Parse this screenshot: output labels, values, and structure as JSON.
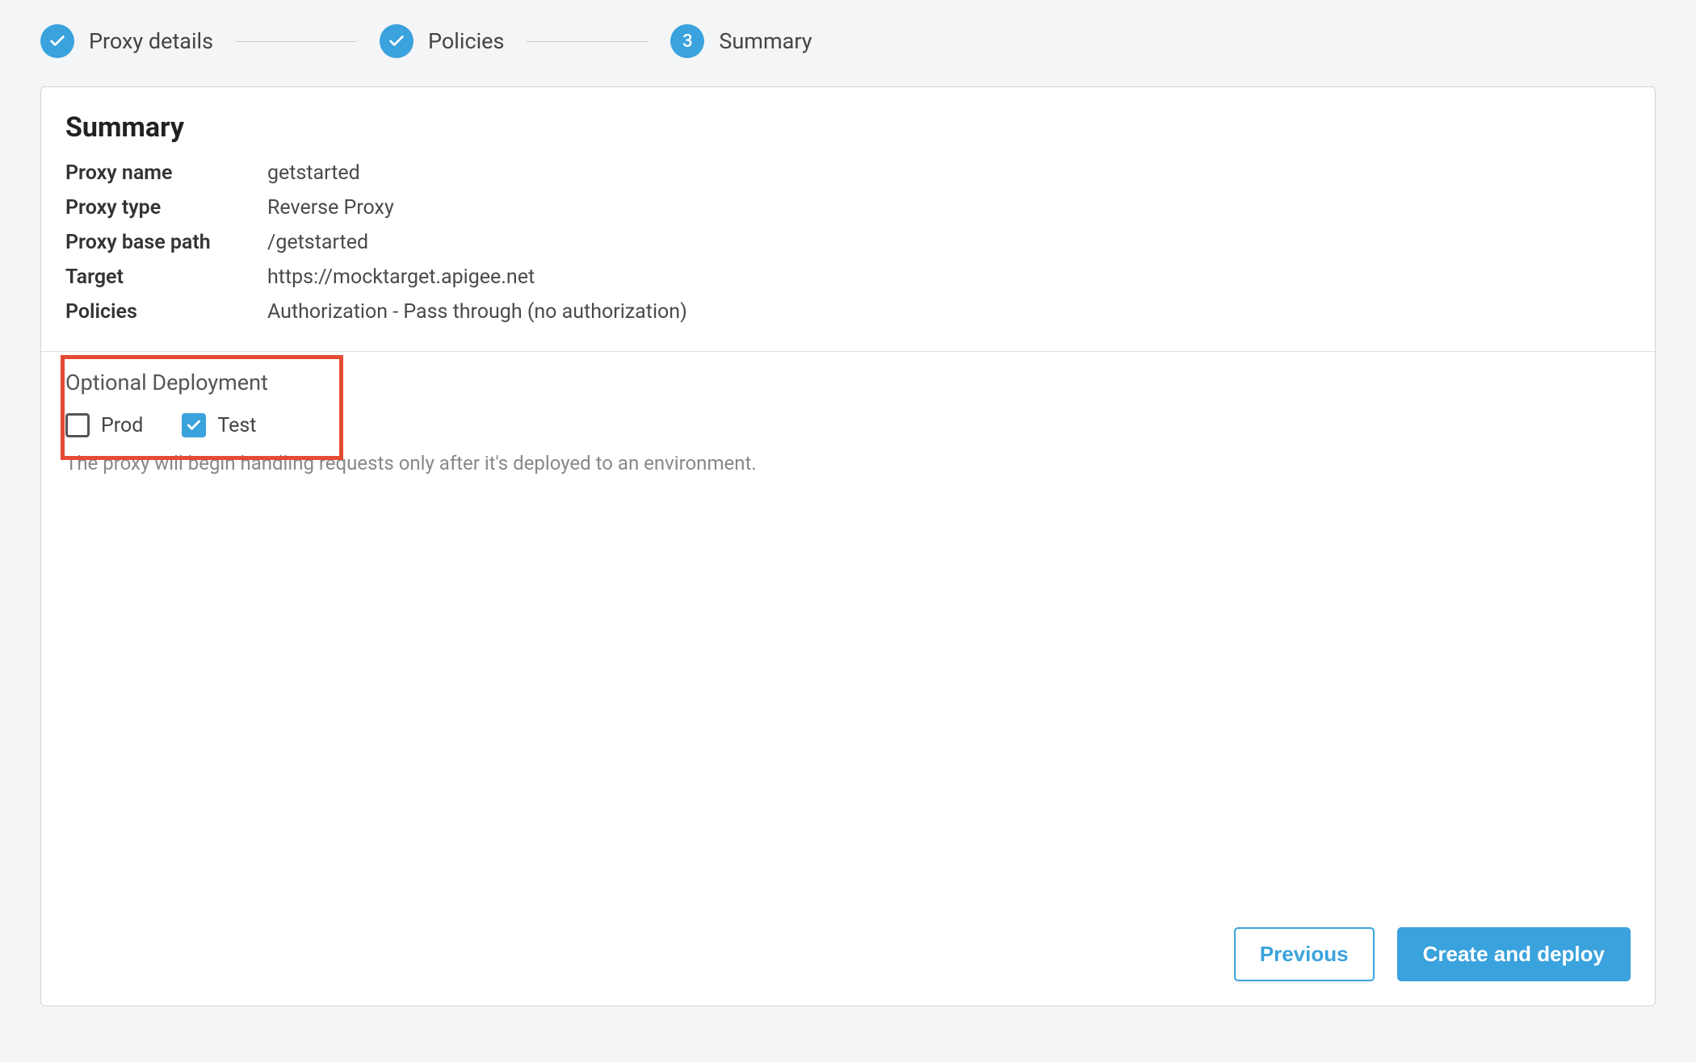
{
  "stepper": {
    "steps": [
      {
        "label": "Proxy details",
        "completed": true
      },
      {
        "label": "Policies",
        "completed": true
      },
      {
        "label": "Summary",
        "number": "3",
        "completed": false
      }
    ]
  },
  "summary": {
    "heading": "Summary",
    "rows": {
      "proxy_name": {
        "label": "Proxy name",
        "value": "getstarted"
      },
      "proxy_type": {
        "label": "Proxy type",
        "value": "Reverse Proxy"
      },
      "proxy_base_path": {
        "label": "Proxy base path",
        "value": "/getstarted"
      },
      "target": {
        "label": "Target",
        "value": "https://mocktarget.apigee.net"
      },
      "policies": {
        "label": "Policies",
        "value": "Authorization - Pass through (no authorization)"
      }
    }
  },
  "deployment": {
    "heading": "Optional Deployment",
    "options": {
      "prod": {
        "label": "Prod",
        "checked": false
      },
      "test": {
        "label": "Test",
        "checked": true
      }
    },
    "helper": "The proxy will begin handling requests only after it's deployed to an environment."
  },
  "footer": {
    "previous": "Previous",
    "create": "Create and deploy"
  }
}
